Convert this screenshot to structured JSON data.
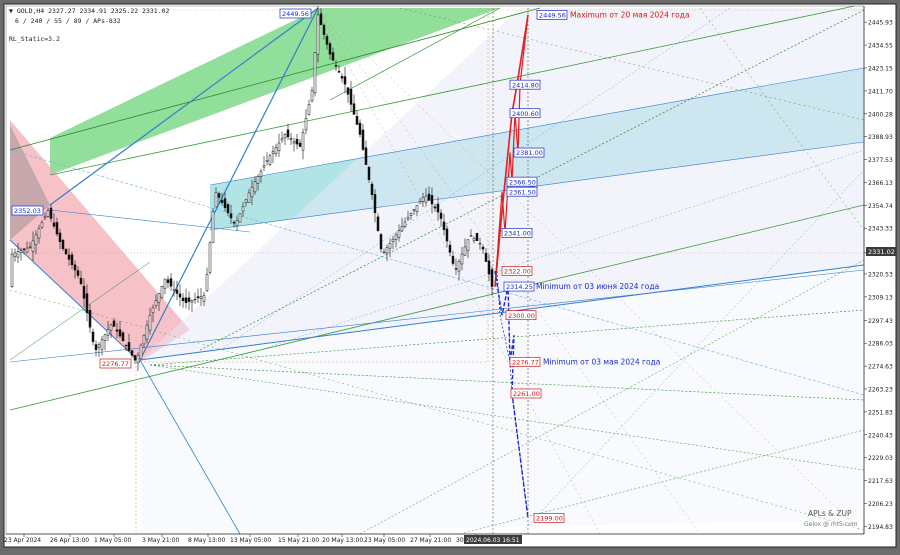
{
  "header": {
    "symbol_line": "▼ GOLD,H4  2327.27 2334.91 2325.22 2331.02",
    "params_line": "6 / 240 / 55 / 89 / APs-832",
    "indicator_line": "RL_Static=3.2"
  },
  "watermark": {
    "line1": "APLs & ZUP",
    "line2": "Gelox @ mt5.com"
  },
  "current_price": "2331.02",
  "time_marker": "2024.06.03 16:51",
  "chart_data": {
    "type": "candlestick",
    "symbol": "GOLD",
    "timeframe": "H4",
    "ylim": [
      2192,
      2452
    ],
    "y_ticks": [
      "2445.93",
      "2434.55",
      "2423.15",
      "2411.70",
      "2400.28",
      "2388.93",
      "2377.53",
      "2366.13",
      "2354.74",
      "2343.33",
      "2331.02",
      "2320.53",
      "2309.13",
      "2297.43",
      "2286.03",
      "2274.63",
      "2263.23",
      "2251.83",
      "2240.43",
      "2229.03",
      "2217.63",
      "2206.23",
      "2194.83"
    ],
    "x_labels": [
      "23 Apr 2024",
      "26 Apr 13:00",
      "1 May 05:00",
      "3 May 21:00",
      "8 May 13:00",
      "13 May 05:00",
      "15 May 21:00",
      "20 May 13:00",
      "23 May 05:00",
      "27 May 21:00",
      "30"
    ],
    "ohlc_summary": {
      "open": 2327.27,
      "high": 2334.91,
      "low": 2325.22,
      "close": 2331.02
    },
    "price_anchors": [
      {
        "date": "23 Apr 2024",
        "price": 2334
      },
      {
        "date": "25 Apr 2024",
        "price": 2352.03
      },
      {
        "date": "3 May 2024",
        "price": 2276.77
      },
      {
        "date": "20 May 2024",
        "price": 2449.56
      },
      {
        "date": "3 Jun 2024",
        "price": 2314.25
      }
    ],
    "projection_levels": [
      {
        "value": "2449.56",
        "color": "blue"
      },
      {
        "value": "2414.80",
        "color": "blue"
      },
      {
        "value": "2400.60",
        "color": "blue"
      },
      {
        "value": "2381.00",
        "color": "blue"
      },
      {
        "value": "2366.50",
        "color": "blue"
      },
      {
        "value": "2361.50",
        "color": "blue"
      },
      {
        "value": "2341.00",
        "color": "blue"
      },
      {
        "value": "2322.00",
        "color": "red"
      },
      {
        "value": "2314.25",
        "color": "blue"
      },
      {
        "value": "2300.00",
        "color": "red"
      },
      {
        "value": "2276.77",
        "color": "red"
      },
      {
        "value": "2261.00",
        "color": "red"
      },
      {
        "value": "2199.00",
        "color": "red"
      }
    ],
    "pivot_labels": [
      {
        "value": "2449.56",
        "color": "blue"
      },
      {
        "value": "2352.03",
        "color": "blue"
      },
      {
        "value": "2276.77",
        "color": "red"
      }
    ],
    "annotations": [
      {
        "text": "Maximum от 20 мая 2024 года",
        "color": "red"
      },
      {
        "text": "Minimum от 03 июня 2024 года",
        "color": "blue"
      },
      {
        "text": "Minimum от 03 мая 2024 года",
        "color": "blue"
      }
    ],
    "bullish_path": [
      "2314.25",
      "2341.00",
      "2361.50",
      "2381.00",
      "2400.60",
      "2414.80",
      "2449.56"
    ],
    "bearish_path": [
      "2322.00",
      "2300.00",
      "2276.77",
      "2261.00",
      "2199.00"
    ]
  }
}
